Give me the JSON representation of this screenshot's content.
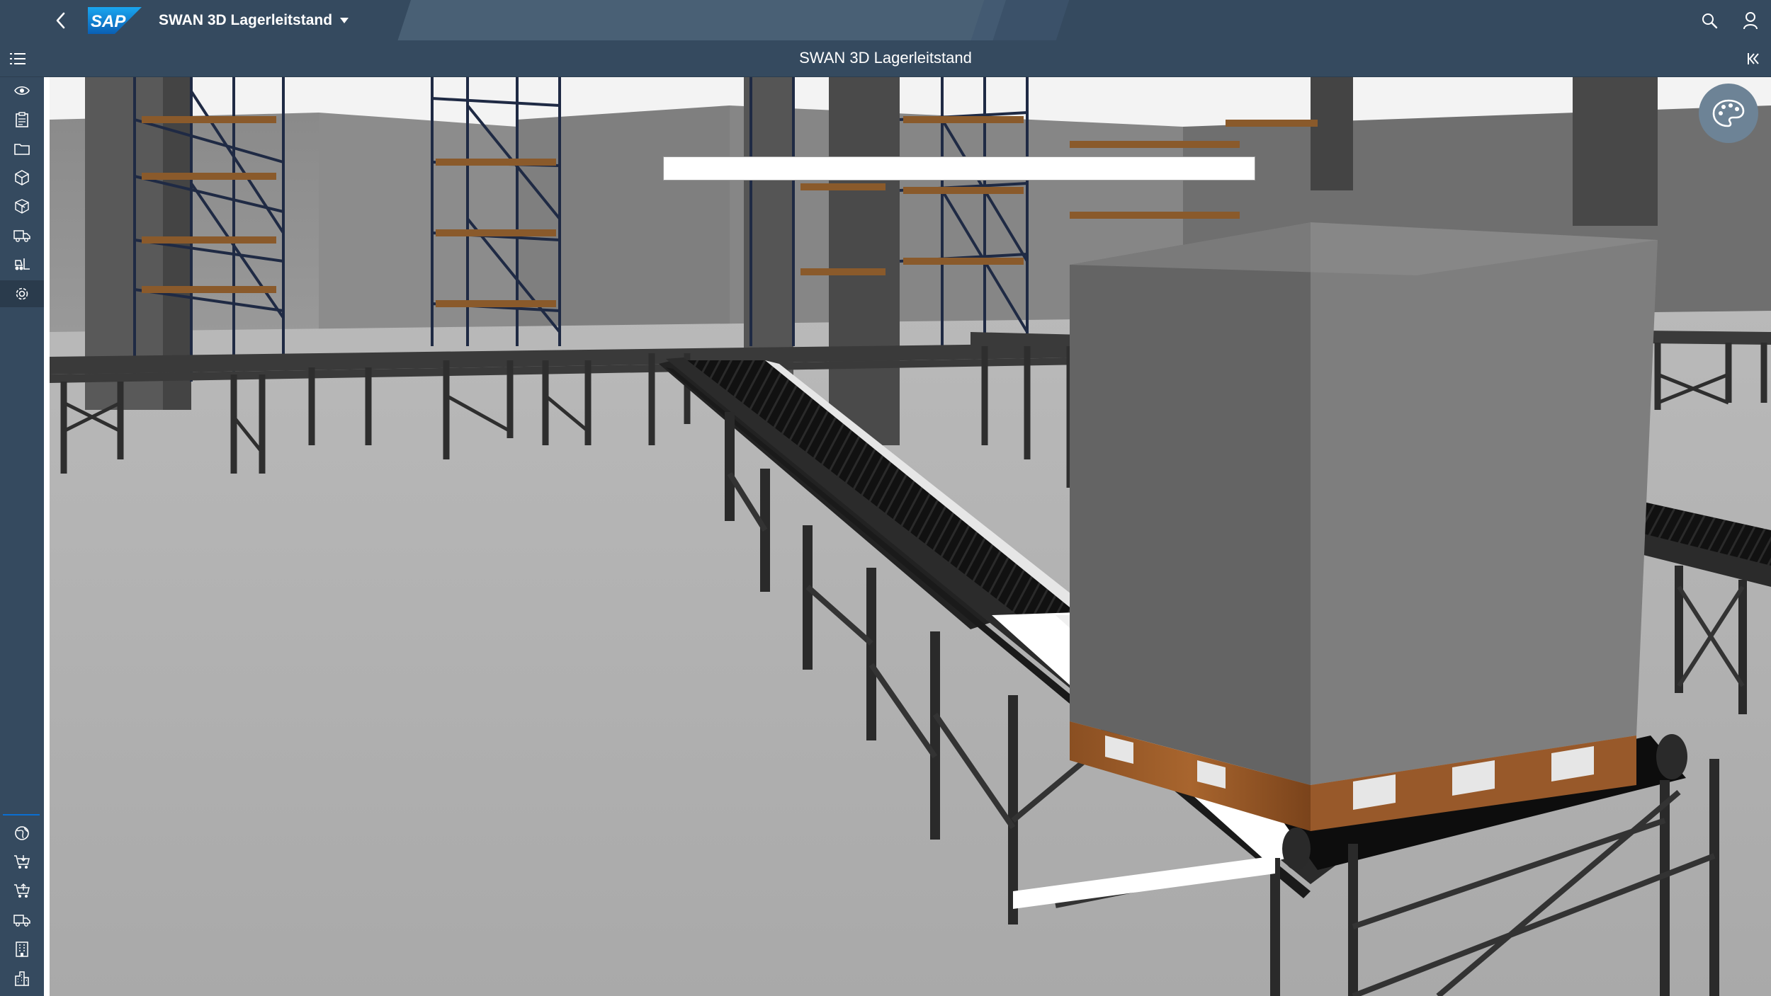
{
  "shell": {
    "app_title": "SWAN 3D Lagerleitstand",
    "logo_text": "SAP",
    "icons": {
      "back": "chevron-left-icon",
      "title_dropdown": "caret-down-icon",
      "search": "search-icon",
      "user": "user-icon"
    }
  },
  "subheader": {
    "title": "SWAN 3D Lagerleitstand",
    "icons": {
      "menu": "list-icon",
      "collapse": "collapse-left-icon"
    }
  },
  "rail": {
    "top_items": [
      "eye-icon",
      "clipboard-icon",
      "folder-icon",
      "cube-icon",
      "cubes-icon",
      "truck-icon",
      "forklift-icon",
      "settings-icon"
    ],
    "active_item": "settings-icon",
    "bottom_items": [
      "globe-icon",
      "cart-in-icon",
      "cart-out-icon",
      "truck-icon",
      "building-icon",
      "warehouse-icon"
    ]
  },
  "viewer": {
    "search_value": "",
    "search_placeholder": "",
    "palette_icon": "palette-icon"
  },
  "colors": {
    "shell": "#354a5f",
    "accent": "#0a6ed1",
    "palette_button": "#6d8396"
  }
}
